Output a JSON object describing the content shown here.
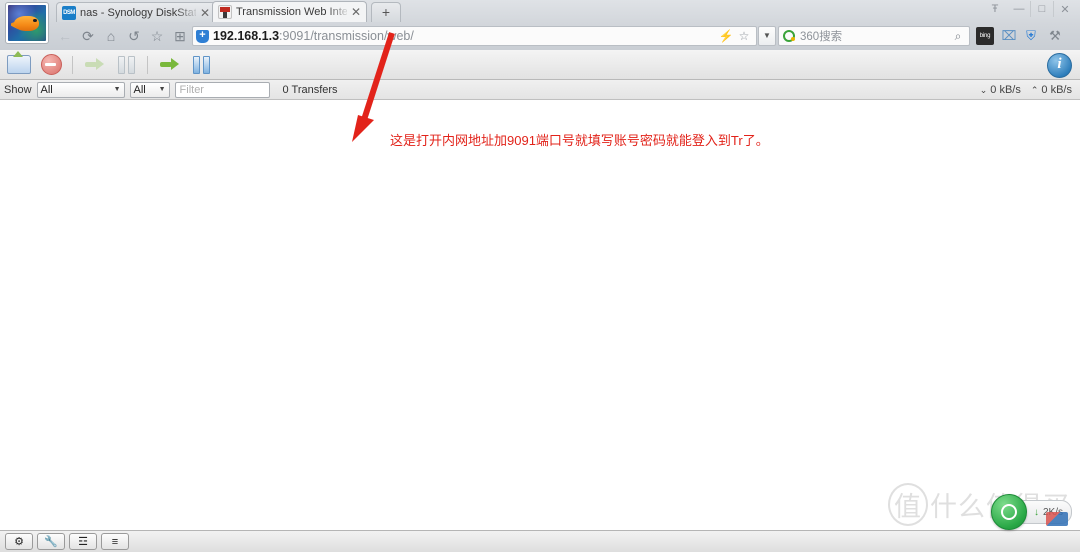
{
  "window": {
    "controls": [
      {
        "name": "skin-icon",
        "glyph": "Ŧ"
      },
      {
        "name": "minimize-icon",
        "glyph": "—"
      },
      {
        "name": "maximize-icon",
        "glyph": "□"
      },
      {
        "name": "close-icon",
        "glyph": "✕"
      }
    ]
  },
  "browser": {
    "tabs": [
      {
        "title": "nas - Synology DiskStatio",
        "favicon": "dsm-favicon",
        "favicon_text": "DSM",
        "close": "✕",
        "active": false
      },
      {
        "title": "Transmission Web Interf",
        "favicon": "transmission-favicon",
        "close": "✕",
        "active": true
      }
    ],
    "new_tab_label": "+",
    "nav_icons": [
      {
        "name": "back-icon",
        "glyph": "←",
        "disabled": true
      },
      {
        "name": "reload-icon",
        "glyph": "⟳",
        "disabled": false
      },
      {
        "name": "home-icon",
        "glyph": "⌂",
        "disabled": false
      },
      {
        "name": "history-icon",
        "glyph": "↺",
        "disabled": false
      },
      {
        "name": "favorites-star-icon",
        "glyph": "☆",
        "disabled": false
      },
      {
        "name": "apps-grid-icon",
        "glyph": "⊞",
        "disabled": false
      }
    ],
    "url": {
      "host": "192.168.1.3",
      "path": ":9091/transmission/web/",
      "security_icon": "shield-icon",
      "lightning_icon": "⚡",
      "star_icon": "☆",
      "dropdown_caret": "▼"
    },
    "search": {
      "engine": "360搜索",
      "placeholder": "360搜索",
      "magnifier": "⌕"
    },
    "extensions": [
      {
        "name": "bing-extension-icon",
        "label": "bing"
      },
      {
        "name": "screenshot-extension-icon",
        "label": "⌧"
      },
      {
        "name": "security-shield-extension-icon",
        "label": "⛨"
      },
      {
        "name": "tools-wrench-extension-icon",
        "label": "⚒"
      }
    ]
  },
  "transmission": {
    "toolbar": [
      {
        "name": "open-torrent-button",
        "title": "Open Torrent"
      },
      {
        "name": "remove-torrent-button",
        "title": "Remove"
      },
      {
        "name": "start-torrent-button",
        "title": "Start"
      },
      {
        "name": "pause-torrent-button",
        "title": "Pause"
      },
      {
        "name": "start-all-button",
        "title": "Start All"
      },
      {
        "name": "pause-all-button",
        "title": "Pause All"
      },
      {
        "name": "inspector-button",
        "title": "Toggle Inspector"
      }
    ],
    "filterbar": {
      "show_label": "Show",
      "state_filter": "All",
      "tracker_filter": "All",
      "filter_placeholder": "Filter",
      "filter_value": "",
      "transfers_count": "0 Transfers",
      "caret": "▼"
    },
    "speeds": {
      "down_arrow": "⌄",
      "down_rate": "0 kB/s",
      "up_arrow": "⌃",
      "up_rate": "0 kB/s"
    },
    "statusbar_buttons": [
      {
        "name": "preferences-gear-button",
        "glyph": "⚙"
      },
      {
        "name": "wrench-tools-button",
        "glyph": "🔧"
      },
      {
        "name": "turtle-speed-limit-button",
        "glyph": "☲"
      },
      {
        "name": "compact-view-button",
        "glyph": "≡"
      }
    ]
  },
  "annotation": {
    "text": "这是打开内网地址加9091端口号就填写账号密码就能登入到Tr了。",
    "color": "#e2231a"
  },
  "watermark": {
    "mark": "值",
    "text": "什么值得买"
  },
  "float_widget": {
    "down_arrow": "↓",
    "speed": "2K/s"
  },
  "colors": {
    "accent_red": "#e2231a",
    "chrome_bg": "#d2d6db",
    "toolbar_bg": "#e2e2e2",
    "green": "#79b83b",
    "blue": "#2c7cba"
  }
}
